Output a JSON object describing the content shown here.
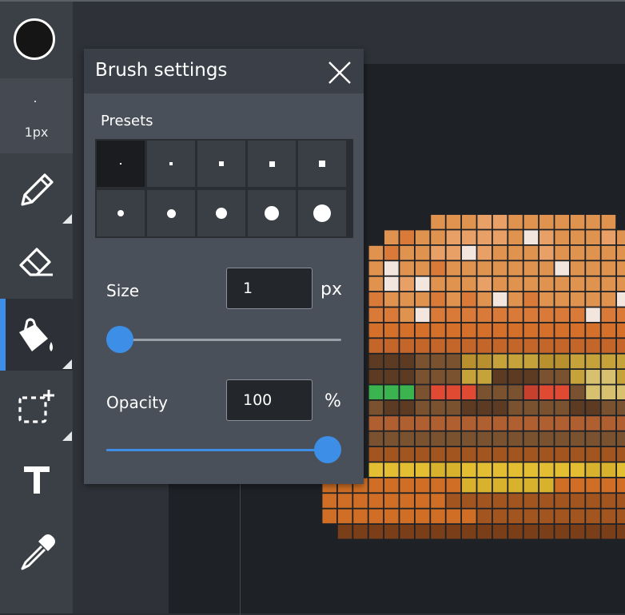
{
  "colors": {
    "accent": "#3d8ee6",
    "primary_color": "#151515"
  },
  "toolbar": {
    "size_label": "1px",
    "tools": [
      {
        "name": "pencil-tool",
        "icon": "pencil-icon",
        "active": false
      },
      {
        "name": "eraser-tool",
        "icon": "eraser-icon",
        "active": false
      },
      {
        "name": "fill-tool",
        "icon": "paint-bucket-icon",
        "active": true
      },
      {
        "name": "select-tool",
        "icon": "add-selection-icon",
        "active": false
      },
      {
        "name": "text-tool",
        "icon": "text-icon",
        "active": false
      },
      {
        "name": "eyedropper-tool",
        "icon": "eyedropper-icon",
        "active": false
      }
    ]
  },
  "panel": {
    "title": "Brush settings",
    "presets_label": "Presets",
    "presets_selected": 0,
    "size_label": "Size",
    "size_value": "1",
    "size_unit": "px",
    "size_slider_fraction": 0,
    "opacity_label": "Opacity",
    "opacity_value": "100",
    "opacity_unit": "%",
    "opacity_slider_fraction": 1
  },
  "canvas": {
    "subject": "pixel-art burger"
  }
}
